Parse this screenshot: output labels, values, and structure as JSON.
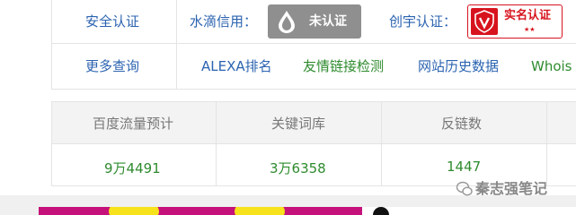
{
  "rows": {
    "verify": {
      "label": "安全认证",
      "water": {
        "label": "水滴信用：",
        "badge": "未认证"
      },
      "chuangyu": {
        "label": "创宇认证：",
        "badge": "实名认证",
        "stars": "★★"
      }
    },
    "more": {
      "label": "更多查询",
      "links": [
        "ALEXA排名",
        "友情链接检测",
        "网站历史数据",
        "Whois"
      ]
    }
  },
  "stats": {
    "headers": [
      "百度流量预计",
      "关键词库",
      "反链数"
    ],
    "values": [
      "9万4491",
      "3万6358",
      "1447"
    ]
  },
  "watermark": "秦志强笔记",
  "colors": {
    "link_blue": "#2b63b0",
    "link_green": "#2e8b2e",
    "badge_red": "#d7141e"
  }
}
